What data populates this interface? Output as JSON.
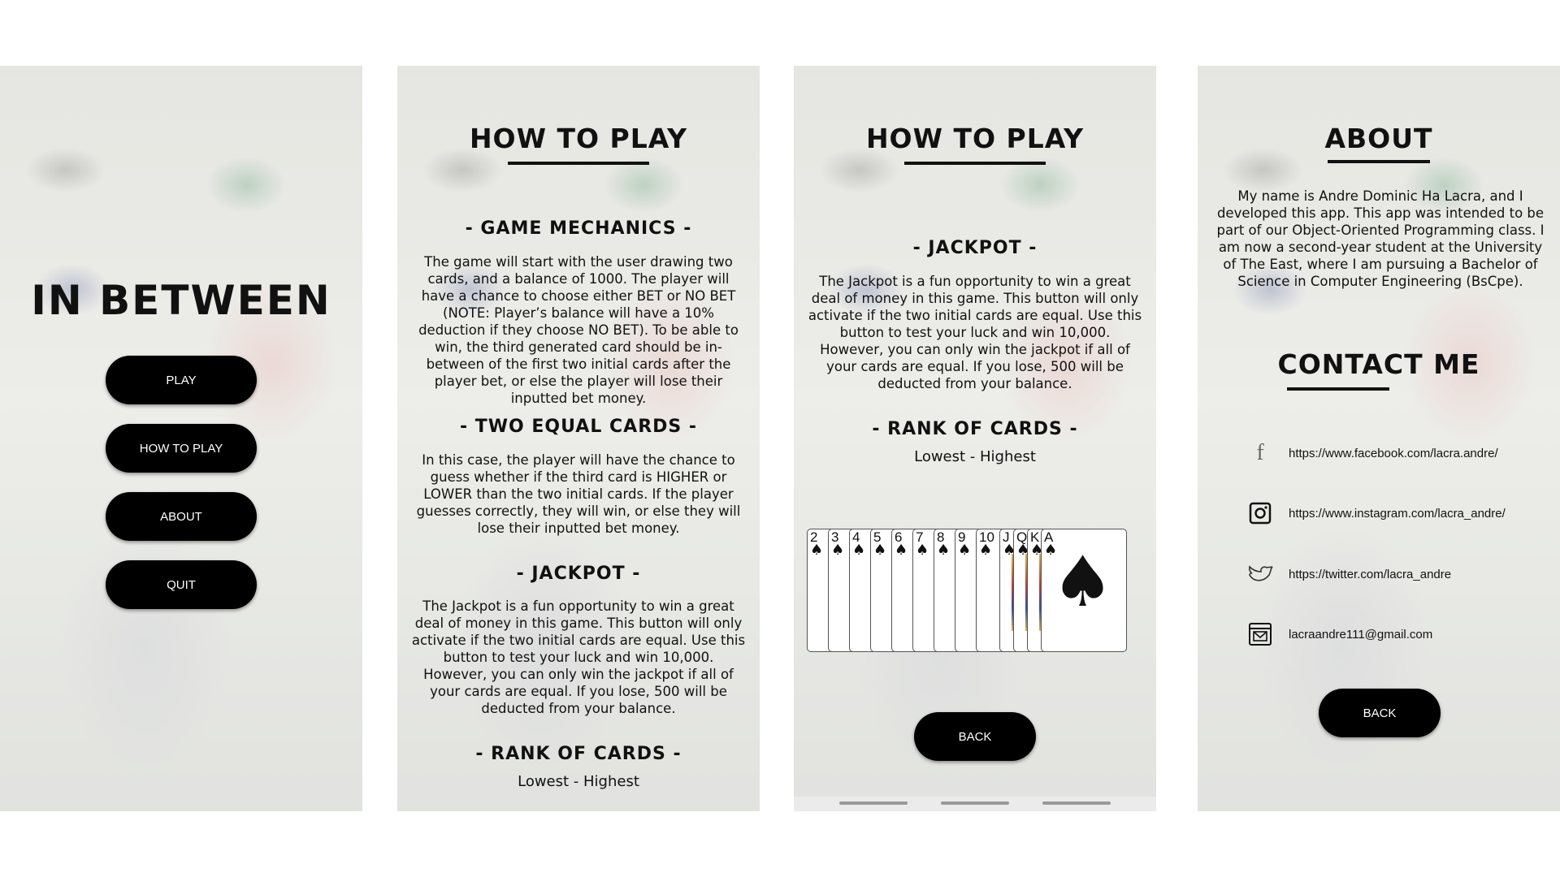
{
  "screen1": {
    "title": "IN BETWEEN",
    "buttons": [
      "PLAY",
      "HOW TO PLAY",
      "ABOUT",
      "QUIT"
    ]
  },
  "screen2": {
    "title": "HOW TO PLAY",
    "sections": [
      {
        "heading": "- GAME MECHANICS -",
        "body": "The game will start with the user drawing two cards, and a balance of 1000. The player will have a chance to choose either BET or NO BET (NOTE: Player’s balance will have a 10% deduction if they choose NO BET). To be able to win, the third generated card should be in-between of the first two initial cards after the player bet, or else the player will lose their inputted bet money."
      },
      {
        "heading": "- TWO EQUAL CARDS -",
        "body": "In this case, the player will have the chance to guess whether if the third card is HIGHER or LOWER than the two initial cards. If the player guesses correctly, they will win, or else they will lose their inputted bet money."
      },
      {
        "heading": "- JACKPOT -",
        "body": "The Jackpot is a fun opportunity to win a great deal of money in this game. This button will only activate if the two initial cards are equal. Use this button to test your luck and win 10,000. However, you can only win the jackpot if all of your cards are equal. If you lose, 500 will be deducted from your balance."
      },
      {
        "heading": "- RANK OF CARDS -",
        "body": "Lowest - Highest"
      }
    ]
  },
  "screen3": {
    "title": "HOW TO PLAY",
    "jackpot_heading": "- JACKPOT -",
    "jackpot_body": "The Jackpot is a fun opportunity to win a great deal of money in this game. This button will only activate if the two initial cards are equal. Use this button to test your luck and win 10,000. However, you can only win the jackpot if all of your cards are equal. If you lose, 500 will be deducted from your balance.",
    "rank_heading": "- RANK OF CARDS -",
    "rank_body": "Lowest - Highest",
    "card_ranks": [
      "2",
      "3",
      "4",
      "5",
      "6",
      "7",
      "8",
      "9",
      "10",
      "J",
      "Q",
      "K",
      "A"
    ],
    "suit_symbol": "♠",
    "back_label": "BACK"
  },
  "screen4": {
    "title": "ABOUT",
    "about_text": "My name is Andre Dominic Ha Lacra, and I developed this app. This app was intended to be part of our Object-Oriented Programming class. I am now a second-year student at the University of The East, where I am pursuing a Bachelor of Science in Computer Engineering (BsCpe).",
    "contact_title": "CONTACT ME",
    "contacts": [
      {
        "icon": "facebook-icon",
        "text": "https://www.facebook.com/lacra.andre/"
      },
      {
        "icon": "instagram-icon",
        "text": "https://www.instagram.com/lacra_andre/"
      },
      {
        "icon": "twitter-icon",
        "text": "https://twitter.com/lacra_andre"
      },
      {
        "icon": "mail-icon",
        "text": "lacraandre111@gmail.com"
      }
    ],
    "back_label": "BACK"
  }
}
